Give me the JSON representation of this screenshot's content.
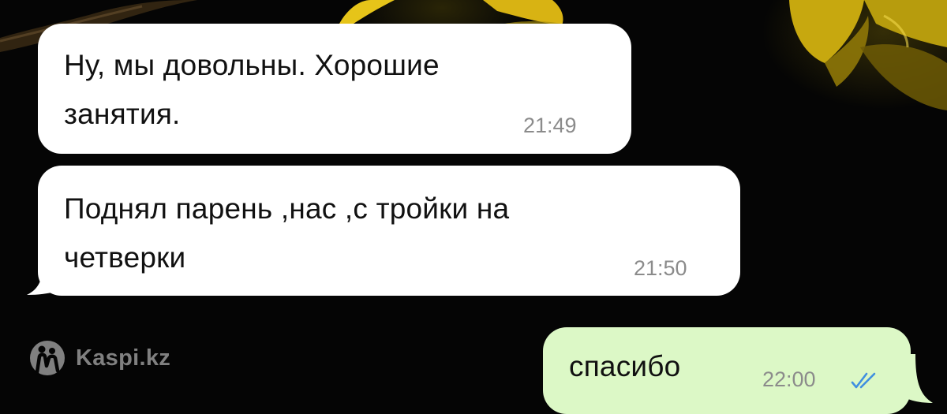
{
  "chat": {
    "messages": [
      {
        "direction": "incoming",
        "lines": [
          "Ну, мы довольны. Хорошие",
          "занятия."
        ],
        "time": "21:49"
      },
      {
        "direction": "incoming",
        "lines": [
          "Поднял парень ,нас ,с тройки  на",
          "четверки"
        ],
        "time": "21:50"
      },
      {
        "direction": "outgoing",
        "lines": [
          "спасибо"
        ],
        "time": "22:00",
        "status_icon": "double-check-read-icon"
      }
    ]
  },
  "watermark": {
    "logo_icon": "kaspi-logo-icon",
    "text": "Kaspi.kz"
  },
  "colors": {
    "background": "#050505",
    "incoming_bubble": "#ffffff",
    "outgoing_bubble": "#dcf8c6",
    "message_text": "#111111",
    "timestamp": "#8b8b8b",
    "read_check": "#3f8fe0",
    "flower_yellow": "#e6c419"
  }
}
